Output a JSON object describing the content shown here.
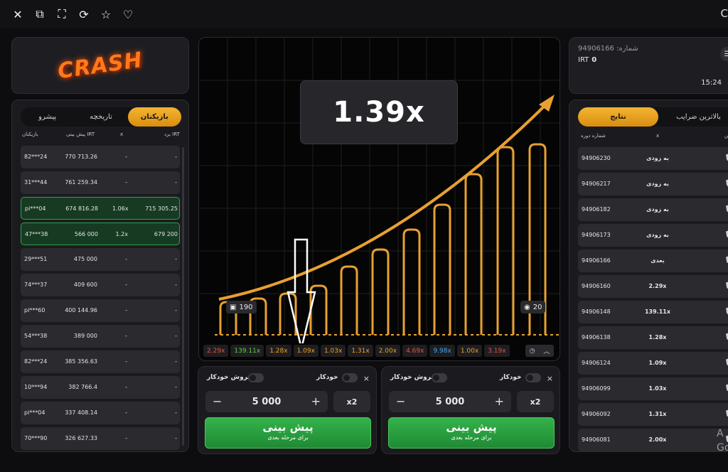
{
  "topbar": {
    "icons": [
      "close-icon",
      "restore-icon",
      "fullscreen-icon",
      "refresh-icon",
      "star-icon",
      "heart-icon"
    ],
    "cut_text": "C"
  },
  "logo": {
    "text": "CRASH"
  },
  "players": {
    "tabs": [
      "پیشرو",
      "تاریخچه",
      "بازیکنان"
    ],
    "active_tab": "بازیکنان",
    "headers": {
      "user": "بازیکنان",
      "bet": "پیش بینی IRT",
      "x": "x",
      "win": "برد IRT"
    },
    "rows": [
      {
        "user": "82***24",
        "bet": "770 713.26",
        "x": "-",
        "win": "-",
        "won": false
      },
      {
        "user": "31***44",
        "bet": "761 259.34",
        "x": "-",
        "win": "-",
        "won": false
      },
      {
        "user": "pi***04",
        "bet": "674 816.28",
        "x": "1.06x",
        "win": "715 305.25",
        "won": true
      },
      {
        "user": "47***38",
        "bet": "566 000",
        "x": "1.2x",
        "win": "679 200",
        "won": true
      },
      {
        "user": "29***51",
        "bet": "475 000",
        "x": "-",
        "win": "-",
        "won": false
      },
      {
        "user": "74***37",
        "bet": "409 600",
        "x": "-",
        "win": "-",
        "won": false
      },
      {
        "user": "pi***60",
        "bet": "400 144.96",
        "x": "-",
        "win": "-",
        "won": false
      },
      {
        "user": "54***38",
        "bet": "389 000",
        "x": "-",
        "win": "-",
        "won": false
      },
      {
        "user": "82***24",
        "bet": "385 356.63",
        "x": "-",
        "win": "-",
        "won": false
      },
      {
        "user": "10***94",
        "bet": "382 766.4",
        "x": "-",
        "win": "-",
        "won": false
      },
      {
        "user": "pi***04",
        "bet": "337 408.14",
        "x": "-",
        "win": "-",
        "won": false
      },
      {
        "user": "70***90",
        "bet": "326 627.33",
        "x": "-",
        "win": "-",
        "won": false
      }
    ]
  },
  "game": {
    "multiplier": "1.39x",
    "players_count": "190",
    "bets_count": "20",
    "history": [
      {
        "v": "2.29x",
        "c": "#e5533d"
      },
      {
        "v": "139.11x",
        "c": "#5fcf3a"
      },
      {
        "v": "1.28x",
        "c": "#f0a020"
      },
      {
        "v": "1.09x",
        "c": "#f0a020"
      },
      {
        "v": "1.03x",
        "c": "#f0a020"
      },
      {
        "v": "1.31x",
        "c": "#f0a020"
      },
      {
        "v": "2.00x",
        "c": "#f0a020"
      },
      {
        "v": "4.69x",
        "c": "#e5533d"
      },
      {
        "v": "9.98x",
        "c": "#3da9f0"
      },
      {
        "v": "1.00x",
        "c": "#f0a020"
      },
      {
        "v": "3.19x",
        "c": "#e5533d"
      }
    ]
  },
  "bet_panels": [
    {
      "auto_cashout": "فروش خودکار",
      "auto": "خودکار",
      "close": "×",
      "amount": "5 000",
      "minus": "−",
      "plus": "+",
      "double": "x2",
      "button_title": "پیش بینی",
      "button_sub": "برای مرحله بعدی"
    },
    {
      "auto_cashout": "فروش خودکار",
      "auto": "خودکار",
      "close": "×",
      "amount": "5 000",
      "minus": "−",
      "plus": "+",
      "double": "x2",
      "button_title": "پیش بینی",
      "button_sub": "برای مرحله بعدی"
    }
  ],
  "info": {
    "round_label": "94906166 :شماره",
    "currency": "IRT",
    "balance": "0",
    "time": "15:24"
  },
  "results": {
    "tabs": [
      "بالاترین ضرایب",
      "نتایج"
    ],
    "active_tab": "نتایج",
    "headers": {
      "round": "شماره دوره",
      "x": "x",
      "check": "س"
    },
    "rows": [
      {
        "round": "94906230",
        "res": "به زودی"
      },
      {
        "round": "94906217",
        "res": "به زودی"
      },
      {
        "round": "94906182",
        "res": "به زودی"
      },
      {
        "round": "94906173",
        "res": "به زودی"
      },
      {
        "round": "94906166",
        "res": "بعدی"
      },
      {
        "round": "94906160",
        "res": "2.29x"
      },
      {
        "round": "94906148",
        "res": "139.11x"
      },
      {
        "round": "94906138",
        "res": "1.28x"
      },
      {
        "round": "94906124",
        "res": "1.09x"
      },
      {
        "round": "94906099",
        "res": "1.03x"
      },
      {
        "round": "94906092",
        "res": "1.31x"
      },
      {
        "round": "94906081",
        "res": "2.00x"
      }
    ]
  },
  "watermark": {
    "l1": "A",
    "l2": "Go"
  }
}
